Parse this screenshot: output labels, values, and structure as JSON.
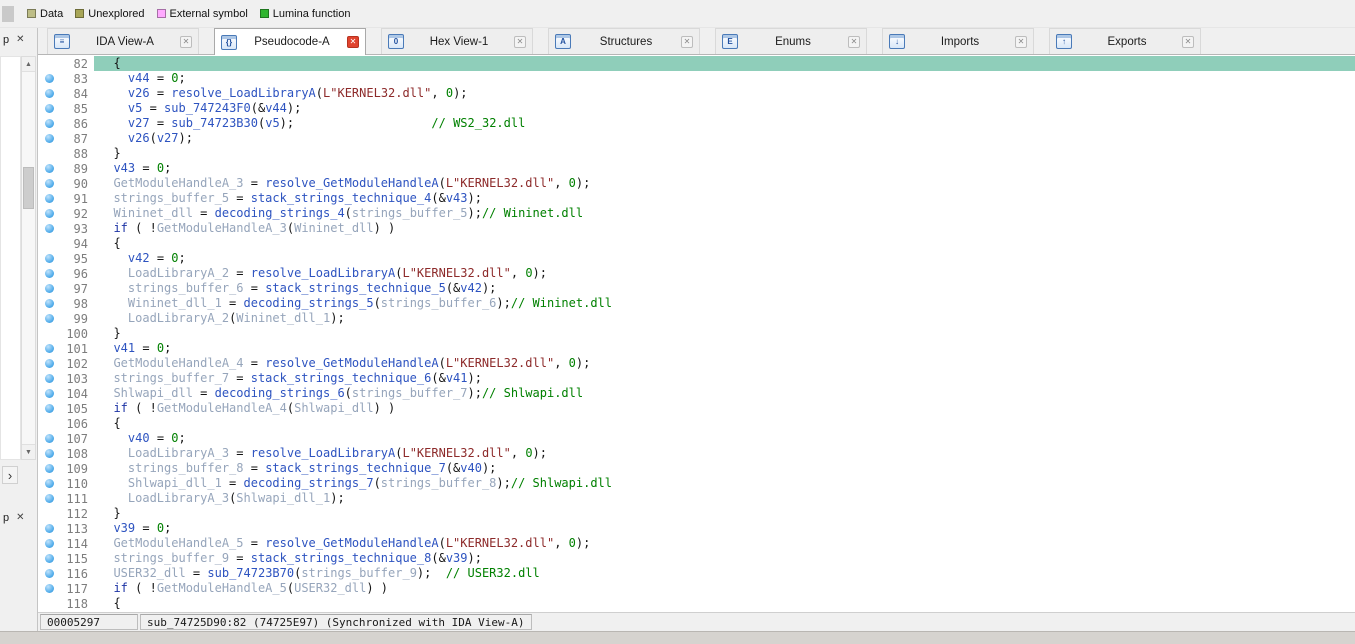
{
  "colors": {
    "window_bg": "#f0f0f0",
    "code_bg": "#ffffff",
    "current_line": "#8fceba",
    "ident_blue": "#2d53c0",
    "ident_gray": "#96a5bb",
    "string_red": "#8d2a2a",
    "number_green": "#008000",
    "comment_green": "#008000",
    "keyword_navy": "#1c32a4",
    "plain_text": "#141414",
    "line_number": "#7d7d7d",
    "bullet_blue": "#58b0ec",
    "close_red": "#e0432e"
  },
  "legend": {
    "items": [
      {
        "label": "Data",
        "color": "#bdbd86"
      },
      {
        "label": "Unexplored",
        "color": "#a8a657"
      },
      {
        "label": "External symbol",
        "color": "#ffaaff"
      },
      {
        "label": "Lumina function",
        "color": "#2fb52f"
      }
    ]
  },
  "tabs": [
    {
      "label": "IDA View-A",
      "icon": "ida-view-icon",
      "glyph": "≡",
      "active": false
    },
    {
      "label": "Pseudocode-A",
      "icon": "pseudocode-icon",
      "glyph": "{}",
      "active": true
    },
    {
      "label": "Hex View-1",
      "icon": "hex-view-icon",
      "glyph": "0",
      "active": false
    },
    {
      "label": "Structures",
      "icon": "structures-icon",
      "glyph": "A",
      "active": false
    },
    {
      "label": "Enums",
      "icon": "enums-icon",
      "glyph": "E",
      "active": false
    },
    {
      "label": "Imports",
      "icon": "imports-icon",
      "glyph": "↓",
      "active": false
    },
    {
      "label": "Exports",
      "icon": "exports-icon",
      "glyph": "↑",
      "active": false
    }
  ],
  "tab_close_glyph": "✕",
  "sidebar": {
    "top_panel_label": "p",
    "bottom_panel_label": "p",
    "close_glyph": "✕",
    "scroll_up_glyph": "▲",
    "scroll_down_glyph": "▼",
    "expand_glyph": "›"
  },
  "status": {
    "address": "00005297",
    "location": "sub_74725D90:82 (74725E97) (Synchronized with IDA View-A)"
  },
  "code": {
    "lines": [
      {
        "n": 82,
        "d": false,
        "h": true,
        "t": [
          [
            "  {",
            "p"
          ]
        ]
      },
      {
        "n": 83,
        "d": true,
        "h": false,
        "t": [
          [
            "    ",
            "p"
          ],
          [
            "v44",
            "b"
          ],
          [
            " = ",
            "p"
          ],
          [
            "0",
            "n"
          ],
          [
            ";",
            "p"
          ]
        ]
      },
      {
        "n": 84,
        "d": true,
        "h": false,
        "t": [
          [
            "    ",
            "p"
          ],
          [
            "v26",
            "b"
          ],
          [
            " = ",
            "p"
          ],
          [
            "resolve_LoadLibraryA",
            "b"
          ],
          [
            "(",
            "p"
          ],
          [
            "L\"KERNEL32.dll\"",
            "s"
          ],
          [
            ", ",
            "p"
          ],
          [
            "0",
            "n"
          ],
          [
            ");",
            "p"
          ]
        ]
      },
      {
        "n": 85,
        "d": true,
        "h": false,
        "t": [
          [
            "    ",
            "p"
          ],
          [
            "v5",
            "b"
          ],
          [
            " = ",
            "p"
          ],
          [
            "sub_747243F0",
            "b"
          ],
          [
            "(&",
            "p"
          ],
          [
            "v44",
            "b"
          ],
          [
            ");",
            "p"
          ]
        ]
      },
      {
        "n": 86,
        "d": true,
        "h": false,
        "t": [
          [
            "    ",
            "p"
          ],
          [
            "v27",
            "b"
          ],
          [
            " = ",
            "p"
          ],
          [
            "sub_74723B30",
            "b"
          ],
          [
            "(",
            "p"
          ],
          [
            "v5",
            "b"
          ],
          [
            ");",
            "p"
          ],
          [
            "                   ",
            "p"
          ],
          [
            "// WS2_32.dll",
            "c"
          ]
        ]
      },
      {
        "n": 87,
        "d": true,
        "h": false,
        "t": [
          [
            "    ",
            "p"
          ],
          [
            "v26",
            "b"
          ],
          [
            "(",
            "p"
          ],
          [
            "v27",
            "b"
          ],
          [
            ");",
            "p"
          ]
        ]
      },
      {
        "n": 88,
        "d": false,
        "h": false,
        "t": [
          [
            "  }",
            "p"
          ]
        ]
      },
      {
        "n": 89,
        "d": true,
        "h": false,
        "t": [
          [
            "  ",
            "p"
          ],
          [
            "v43",
            "b"
          ],
          [
            " = ",
            "p"
          ],
          [
            "0",
            "n"
          ],
          [
            ";",
            "p"
          ]
        ]
      },
      {
        "n": 90,
        "d": true,
        "h": false,
        "t": [
          [
            "  ",
            "p"
          ],
          [
            "GetModuleHandleA_3",
            "g"
          ],
          [
            " = ",
            "p"
          ],
          [
            "resolve_GetModuleHandleA",
            "b"
          ],
          [
            "(",
            "p"
          ],
          [
            "L\"KERNEL32.dll\"",
            "s"
          ],
          [
            ", ",
            "p"
          ],
          [
            "0",
            "n"
          ],
          [
            ");",
            "p"
          ]
        ]
      },
      {
        "n": 91,
        "d": true,
        "h": false,
        "t": [
          [
            "  ",
            "p"
          ],
          [
            "strings_buffer_5",
            "g"
          ],
          [
            " = ",
            "p"
          ],
          [
            "stack_strings_technique_4",
            "b"
          ],
          [
            "(&",
            "p"
          ],
          [
            "v43",
            "b"
          ],
          [
            ");",
            "p"
          ]
        ]
      },
      {
        "n": 92,
        "d": true,
        "h": false,
        "t": [
          [
            "  ",
            "p"
          ],
          [
            "Wininet_dll",
            "g"
          ],
          [
            " = ",
            "p"
          ],
          [
            "decoding_strings_4",
            "b"
          ],
          [
            "(",
            "p"
          ],
          [
            "strings_buffer_5",
            "g"
          ],
          [
            ");",
            "p"
          ],
          [
            "// Wininet.dll",
            "c"
          ]
        ]
      },
      {
        "n": 93,
        "d": true,
        "h": false,
        "t": [
          [
            "  ",
            "p"
          ],
          [
            "if",
            "k"
          ],
          [
            " ( !",
            "p"
          ],
          [
            "GetModuleHandleA_3",
            "g"
          ],
          [
            "(",
            "p"
          ],
          [
            "Wininet_dll",
            "g"
          ],
          [
            ") )",
            "p"
          ]
        ]
      },
      {
        "n": 94,
        "d": false,
        "h": false,
        "t": [
          [
            "  {",
            "p"
          ]
        ]
      },
      {
        "n": 95,
        "d": true,
        "h": false,
        "t": [
          [
            "    ",
            "p"
          ],
          [
            "v42",
            "b"
          ],
          [
            " = ",
            "p"
          ],
          [
            "0",
            "n"
          ],
          [
            ";",
            "p"
          ]
        ]
      },
      {
        "n": 96,
        "d": true,
        "h": false,
        "t": [
          [
            "    ",
            "p"
          ],
          [
            "LoadLibraryA_2",
            "g"
          ],
          [
            " = ",
            "p"
          ],
          [
            "resolve_LoadLibraryA",
            "b"
          ],
          [
            "(",
            "p"
          ],
          [
            "L\"KERNEL32.dll\"",
            "s"
          ],
          [
            ", ",
            "p"
          ],
          [
            "0",
            "n"
          ],
          [
            ");",
            "p"
          ]
        ]
      },
      {
        "n": 97,
        "d": true,
        "h": false,
        "t": [
          [
            "    ",
            "p"
          ],
          [
            "strings_buffer_6",
            "g"
          ],
          [
            " = ",
            "p"
          ],
          [
            "stack_strings_technique_5",
            "b"
          ],
          [
            "(&",
            "p"
          ],
          [
            "v42",
            "b"
          ],
          [
            ");",
            "p"
          ]
        ]
      },
      {
        "n": 98,
        "d": true,
        "h": false,
        "t": [
          [
            "    ",
            "p"
          ],
          [
            "Wininet_dll_1",
            "g"
          ],
          [
            " = ",
            "p"
          ],
          [
            "decoding_strings_5",
            "b"
          ],
          [
            "(",
            "p"
          ],
          [
            "strings_buffer_6",
            "g"
          ],
          [
            ");",
            "p"
          ],
          [
            "// Wininet.dll",
            "c"
          ]
        ]
      },
      {
        "n": 99,
        "d": true,
        "h": false,
        "t": [
          [
            "    ",
            "p"
          ],
          [
            "LoadLibraryA_2",
            "g"
          ],
          [
            "(",
            "p"
          ],
          [
            "Wininet_dll_1",
            "g"
          ],
          [
            ");",
            "p"
          ]
        ]
      },
      {
        "n": 100,
        "d": false,
        "h": false,
        "t": [
          [
            "  }",
            "p"
          ]
        ]
      },
      {
        "n": 101,
        "d": true,
        "h": false,
        "t": [
          [
            "  ",
            "p"
          ],
          [
            "v41",
            "b"
          ],
          [
            " = ",
            "p"
          ],
          [
            "0",
            "n"
          ],
          [
            ";",
            "p"
          ]
        ]
      },
      {
        "n": 102,
        "d": true,
        "h": false,
        "t": [
          [
            "  ",
            "p"
          ],
          [
            "GetModuleHandleA_4",
            "g"
          ],
          [
            " = ",
            "p"
          ],
          [
            "resolve_GetModuleHandleA",
            "b"
          ],
          [
            "(",
            "p"
          ],
          [
            "L\"KERNEL32.dll\"",
            "s"
          ],
          [
            ", ",
            "p"
          ],
          [
            "0",
            "n"
          ],
          [
            ");",
            "p"
          ]
        ]
      },
      {
        "n": 103,
        "d": true,
        "h": false,
        "t": [
          [
            "  ",
            "p"
          ],
          [
            "strings_buffer_7",
            "g"
          ],
          [
            " = ",
            "p"
          ],
          [
            "stack_strings_technique_6",
            "b"
          ],
          [
            "(&",
            "p"
          ],
          [
            "v41",
            "b"
          ],
          [
            ");",
            "p"
          ]
        ]
      },
      {
        "n": 104,
        "d": true,
        "h": false,
        "t": [
          [
            "  ",
            "p"
          ],
          [
            "Shlwapi_dll",
            "g"
          ],
          [
            " = ",
            "p"
          ],
          [
            "decoding_strings_6",
            "b"
          ],
          [
            "(",
            "p"
          ],
          [
            "strings_buffer_7",
            "g"
          ],
          [
            ");",
            "p"
          ],
          [
            "// Shlwapi.dll",
            "c"
          ]
        ]
      },
      {
        "n": 105,
        "d": true,
        "h": false,
        "t": [
          [
            "  ",
            "p"
          ],
          [
            "if",
            "k"
          ],
          [
            " ( !",
            "p"
          ],
          [
            "GetModuleHandleA_4",
            "g"
          ],
          [
            "(",
            "p"
          ],
          [
            "Shlwapi_dll",
            "g"
          ],
          [
            ") )",
            "p"
          ]
        ]
      },
      {
        "n": 106,
        "d": false,
        "h": false,
        "t": [
          [
            "  {",
            "p"
          ]
        ]
      },
      {
        "n": 107,
        "d": true,
        "h": false,
        "t": [
          [
            "    ",
            "p"
          ],
          [
            "v40",
            "b"
          ],
          [
            " = ",
            "p"
          ],
          [
            "0",
            "n"
          ],
          [
            ";",
            "p"
          ]
        ]
      },
      {
        "n": 108,
        "d": true,
        "h": false,
        "t": [
          [
            "    ",
            "p"
          ],
          [
            "LoadLibraryA_3",
            "g"
          ],
          [
            " = ",
            "p"
          ],
          [
            "resolve_LoadLibraryA",
            "b"
          ],
          [
            "(",
            "p"
          ],
          [
            "L\"KERNEL32.dll\"",
            "s"
          ],
          [
            ", ",
            "p"
          ],
          [
            "0",
            "n"
          ],
          [
            ");",
            "p"
          ]
        ]
      },
      {
        "n": 109,
        "d": true,
        "h": false,
        "t": [
          [
            "    ",
            "p"
          ],
          [
            "strings_buffer_8",
            "g"
          ],
          [
            " = ",
            "p"
          ],
          [
            "stack_strings_technique_7",
            "b"
          ],
          [
            "(&",
            "p"
          ],
          [
            "v40",
            "b"
          ],
          [
            ");",
            "p"
          ]
        ]
      },
      {
        "n": 110,
        "d": true,
        "h": false,
        "t": [
          [
            "    ",
            "p"
          ],
          [
            "Shlwapi_dll_1",
            "g"
          ],
          [
            " = ",
            "p"
          ],
          [
            "decoding_strings_7",
            "b"
          ],
          [
            "(",
            "p"
          ],
          [
            "strings_buffer_8",
            "g"
          ],
          [
            ");",
            "p"
          ],
          [
            "// Shlwapi.dll",
            "c"
          ]
        ]
      },
      {
        "n": 111,
        "d": true,
        "h": false,
        "t": [
          [
            "    ",
            "p"
          ],
          [
            "LoadLibraryA_3",
            "g"
          ],
          [
            "(",
            "p"
          ],
          [
            "Shlwapi_dll_1",
            "g"
          ],
          [
            ");",
            "p"
          ]
        ]
      },
      {
        "n": 112,
        "d": false,
        "h": false,
        "t": [
          [
            "  }",
            "p"
          ]
        ]
      },
      {
        "n": 113,
        "d": true,
        "h": false,
        "t": [
          [
            "  ",
            "p"
          ],
          [
            "v39",
            "b"
          ],
          [
            " = ",
            "p"
          ],
          [
            "0",
            "n"
          ],
          [
            ";",
            "p"
          ]
        ]
      },
      {
        "n": 114,
        "d": true,
        "h": false,
        "t": [
          [
            "  ",
            "p"
          ],
          [
            "GetModuleHandleA_5",
            "g"
          ],
          [
            " = ",
            "p"
          ],
          [
            "resolve_GetModuleHandleA",
            "b"
          ],
          [
            "(",
            "p"
          ],
          [
            "L\"KERNEL32.dll\"",
            "s"
          ],
          [
            ", ",
            "p"
          ],
          [
            "0",
            "n"
          ],
          [
            ");",
            "p"
          ]
        ]
      },
      {
        "n": 115,
        "d": true,
        "h": false,
        "t": [
          [
            "  ",
            "p"
          ],
          [
            "strings_buffer_9",
            "g"
          ],
          [
            " = ",
            "p"
          ],
          [
            "stack_strings_technique_8",
            "b"
          ],
          [
            "(&",
            "p"
          ],
          [
            "v39",
            "b"
          ],
          [
            ");",
            "p"
          ]
        ]
      },
      {
        "n": 116,
        "d": true,
        "h": false,
        "t": [
          [
            "  ",
            "p"
          ],
          [
            "USER32_dll",
            "g"
          ],
          [
            " = ",
            "p"
          ],
          [
            "sub_74723B70",
            "b"
          ],
          [
            "(",
            "p"
          ],
          [
            "strings_buffer_9",
            "g"
          ],
          [
            ");  ",
            "p"
          ],
          [
            "// USER32.dll",
            "c"
          ]
        ]
      },
      {
        "n": 117,
        "d": true,
        "h": false,
        "t": [
          [
            "  ",
            "p"
          ],
          [
            "if",
            "k"
          ],
          [
            " ( !",
            "p"
          ],
          [
            "GetModuleHandleA_5",
            "g"
          ],
          [
            "(",
            "p"
          ],
          [
            "USER32_dll",
            "g"
          ],
          [
            ") )",
            "p"
          ]
        ]
      },
      {
        "n": 118,
        "d": false,
        "h": false,
        "t": [
          [
            "  {",
            "p"
          ]
        ]
      }
    ]
  }
}
